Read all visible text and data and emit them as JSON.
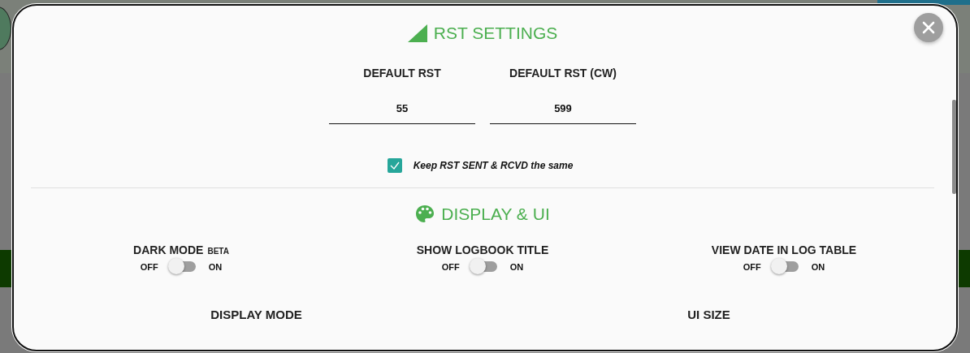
{
  "rst_section": {
    "title": "RST SETTINGS",
    "fields": [
      {
        "label": "DEFAULT RST",
        "value": "55"
      },
      {
        "label": "DEFAULT RST (CW)",
        "value": "599"
      }
    ],
    "sync_checkbox": {
      "label": "Keep RST SENT & RCVD the same",
      "checked": true
    }
  },
  "display_section": {
    "title": "DISPLAY & UI",
    "toggles": [
      {
        "label": "DARK MODE",
        "badge": "BETA",
        "off_label": "OFF",
        "on_label": "ON",
        "on": false
      },
      {
        "label": "SHOW LOGBOOK TITLE",
        "off_label": "OFF",
        "on_label": "ON",
        "on": false
      },
      {
        "label": "VIEW DATE IN LOG TABLE",
        "off_label": "OFF",
        "on_label": "ON",
        "on": false
      }
    ],
    "subsections": [
      {
        "title": "DISPLAY MODE"
      },
      {
        "title": "UI SIZE"
      }
    ]
  }
}
